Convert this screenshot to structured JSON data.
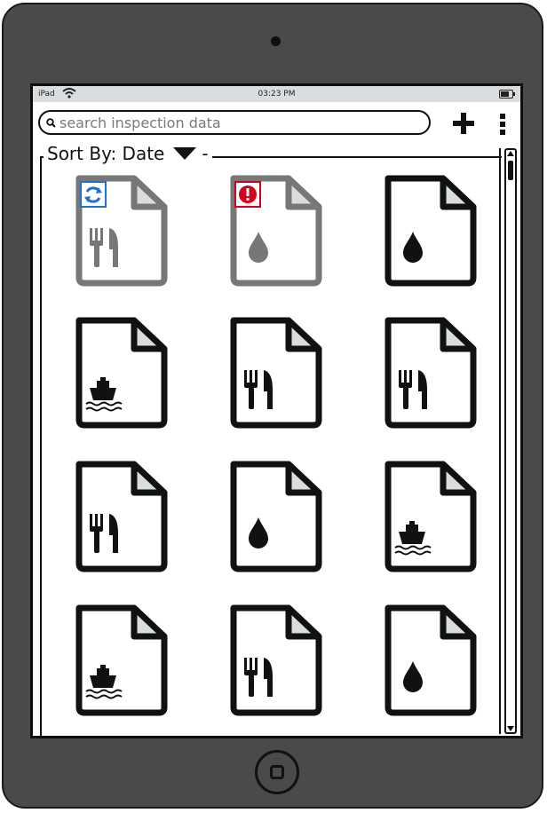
{
  "status_bar": {
    "carrier": "iPad",
    "time": "03:23 PM"
  },
  "search": {
    "placeholder": "search inspection data",
    "value": ""
  },
  "sort": {
    "label": "Sort By: Date",
    "suffix": "-"
  },
  "colors": {
    "device": "#4a4a4a",
    "doc_active": "#111111",
    "doc_muted": "#777777",
    "sync_badge": "#1e6fd9",
    "error_badge": "#d0021b"
  },
  "documents": [
    {
      "category": "fork-knife-icon",
      "state": "syncing",
      "badge": "sync-icon"
    },
    {
      "category": "water-drop-icon",
      "state": "error",
      "badge": "alert-icon"
    },
    {
      "category": "water-drop-icon",
      "state": "normal",
      "badge": ""
    },
    {
      "category": "ship-icon",
      "state": "normal",
      "badge": ""
    },
    {
      "category": "fork-knife-icon",
      "state": "normal",
      "badge": ""
    },
    {
      "category": "fork-knife-icon",
      "state": "normal",
      "badge": ""
    },
    {
      "category": "fork-knife-icon",
      "state": "normal",
      "badge": ""
    },
    {
      "category": "water-drop-icon",
      "state": "normal",
      "badge": ""
    },
    {
      "category": "ship-icon",
      "state": "normal",
      "badge": ""
    },
    {
      "category": "ship-icon",
      "state": "normal",
      "badge": ""
    },
    {
      "category": "fork-knife-icon",
      "state": "normal",
      "badge": ""
    },
    {
      "category": "water-drop-icon",
      "state": "normal",
      "badge": ""
    }
  ]
}
